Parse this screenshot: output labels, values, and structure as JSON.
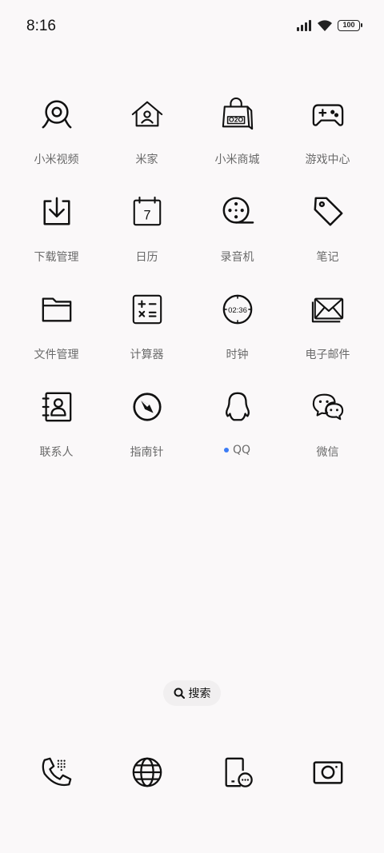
{
  "status_bar": {
    "time": "8:16",
    "battery": "100"
  },
  "apps": [
    {
      "label": "小米视频",
      "icon": "webcam-icon"
    },
    {
      "label": "米家",
      "icon": "home-icon"
    },
    {
      "label": "小米商城",
      "icon": "shopping-bag-icon"
    },
    {
      "label": "游戏中心",
      "icon": "gamepad-icon"
    },
    {
      "label": "下载管理",
      "icon": "download-icon"
    },
    {
      "label": "日历",
      "icon": "calendar-icon"
    },
    {
      "label": "录音机",
      "icon": "tape-reel-icon"
    },
    {
      "label": "笔记",
      "icon": "tag-icon"
    },
    {
      "label": "文件管理",
      "icon": "folder-icon"
    },
    {
      "label": "计算器",
      "icon": "calculator-icon"
    },
    {
      "label": "时钟",
      "icon": "clock-icon"
    },
    {
      "label": "电子邮件",
      "icon": "mail-icon"
    },
    {
      "label": "联系人",
      "icon": "contacts-icon"
    },
    {
      "label": "指南针",
      "icon": "compass-icon"
    },
    {
      "label": "QQ",
      "icon": "qq-penguin-icon",
      "has_new_dot": true
    },
    {
      "label": "微信",
      "icon": "wechat-icon"
    }
  ],
  "calendar_day": "7",
  "clock_time": "02:36",
  "bag_text": "O2O",
  "search": {
    "label": "搜索"
  },
  "dock": [
    {
      "icon": "phone-dialpad-icon"
    },
    {
      "icon": "browser-globe-icon"
    },
    {
      "icon": "messaging-icon"
    },
    {
      "icon": "camera-icon"
    }
  ],
  "colors": {
    "background": "#faf8f9",
    "label": "#6a6a6a",
    "new_dot": "#3b7cf5"
  }
}
